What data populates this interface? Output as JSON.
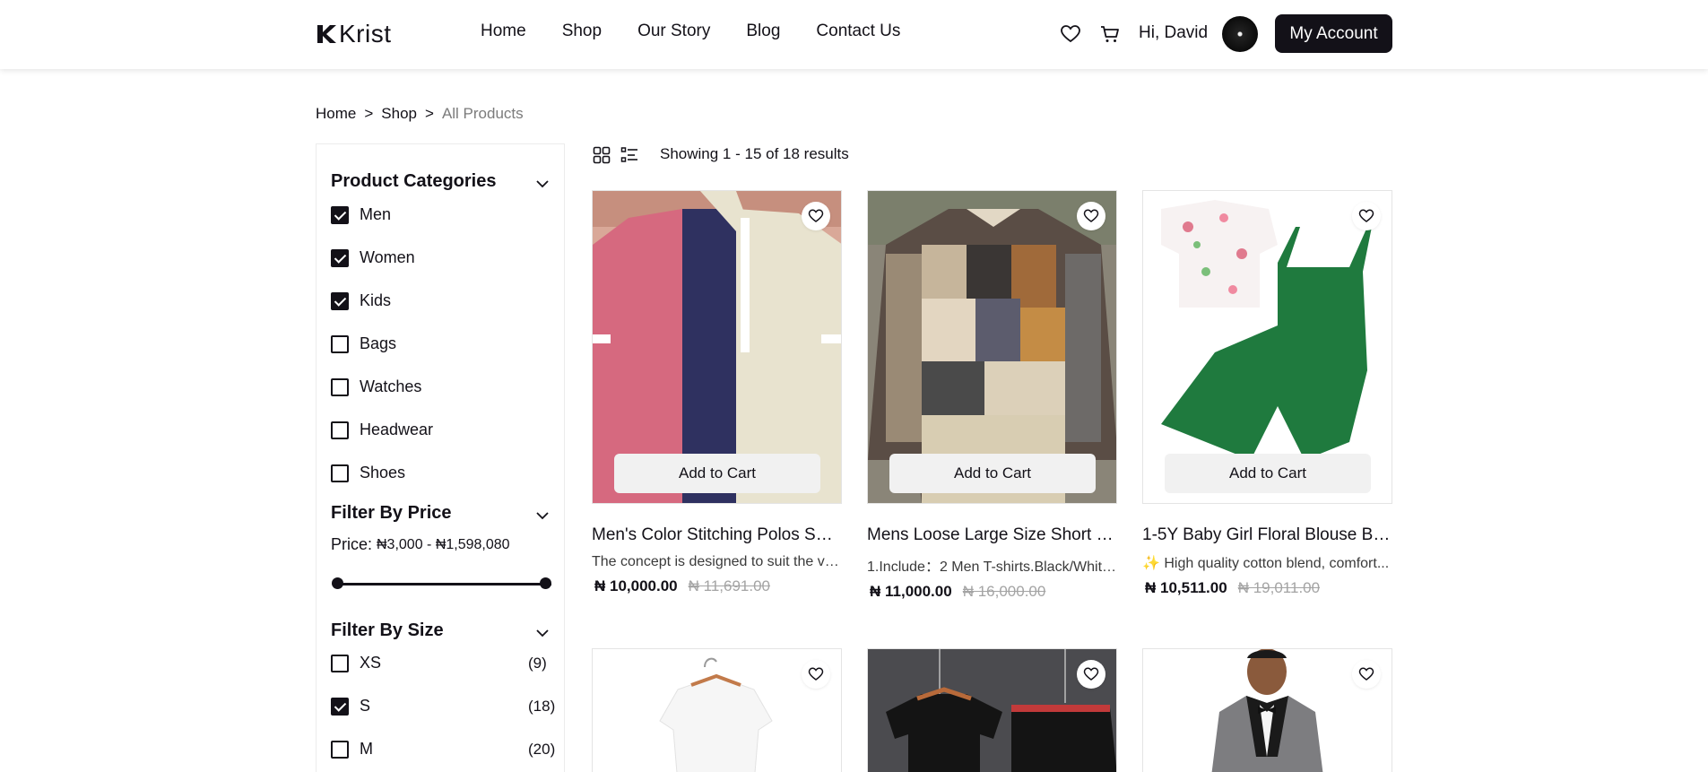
{
  "header": {
    "logo_text": "Krist",
    "nav": [
      "Home",
      "Shop",
      "Our Story",
      "Blog",
      "Contact Us"
    ],
    "greeting": "Hi, David",
    "account_button": "My Account",
    "icons": [
      "heart-icon",
      "cart-icon"
    ]
  },
  "breadcrumb": [
    "Home",
    ">",
    "Shop",
    ">",
    "All Products"
  ],
  "sidebar": {
    "categories_title": "Product Categories",
    "categories": [
      {
        "label": "Men",
        "checked": true
      },
      {
        "label": "Women",
        "checked": true
      },
      {
        "label": "Kids",
        "checked": true
      },
      {
        "label": "Bags",
        "checked": false
      },
      {
        "label": "Watches",
        "checked": false
      },
      {
        "label": "Headwear",
        "checked": false
      },
      {
        "label": "Shoes",
        "checked": false
      }
    ],
    "price_title": "Filter By Price",
    "price_label": "Price:",
    "price_range": "₦3,000 - ₦1,598,080",
    "size_title": "Filter By Size",
    "sizes": [
      {
        "label": "XS",
        "count": "(9)",
        "checked": false
      },
      {
        "label": "S",
        "count": "(18)",
        "checked": true
      },
      {
        "label": "M",
        "count": "(20)",
        "checked": false
      }
    ]
  },
  "toolbar": {
    "result_text": "Showing 1 - 15 of 18 results",
    "view_icons": [
      "grid-view-icon",
      "list-view-icon"
    ]
  },
  "products": [
    {
      "title": "Men's Color Stitching Polos Shirt...",
      "desc": "The concept is designed to suit the ver...",
      "price": "₦ 10,000.00",
      "old_price": "₦ 11,691.00",
      "cart_label": "Add to Cart"
    },
    {
      "title": "Mens Loose Large Size Short Sle...",
      "desc": "1.Include：2 Men T-shirts.Black/White...",
      "price": "₦ 11,000.00",
      "old_price": "₦ 16,000.00",
      "cart_label": "Add to Cart"
    },
    {
      "title": "1-5Y Baby Girl Floral Blouse Bib ...",
      "desc": "✨ High quality cotton blend, comfort...",
      "price": "₦ 10,511.00",
      "old_price": "₦ 19,011.00",
      "cart_label": "Add to Cart"
    }
  ],
  "colors": {
    "primary": "#131118",
    "muted": "#a4a4a4",
    "button_light": "#f1f1f1"
  }
}
